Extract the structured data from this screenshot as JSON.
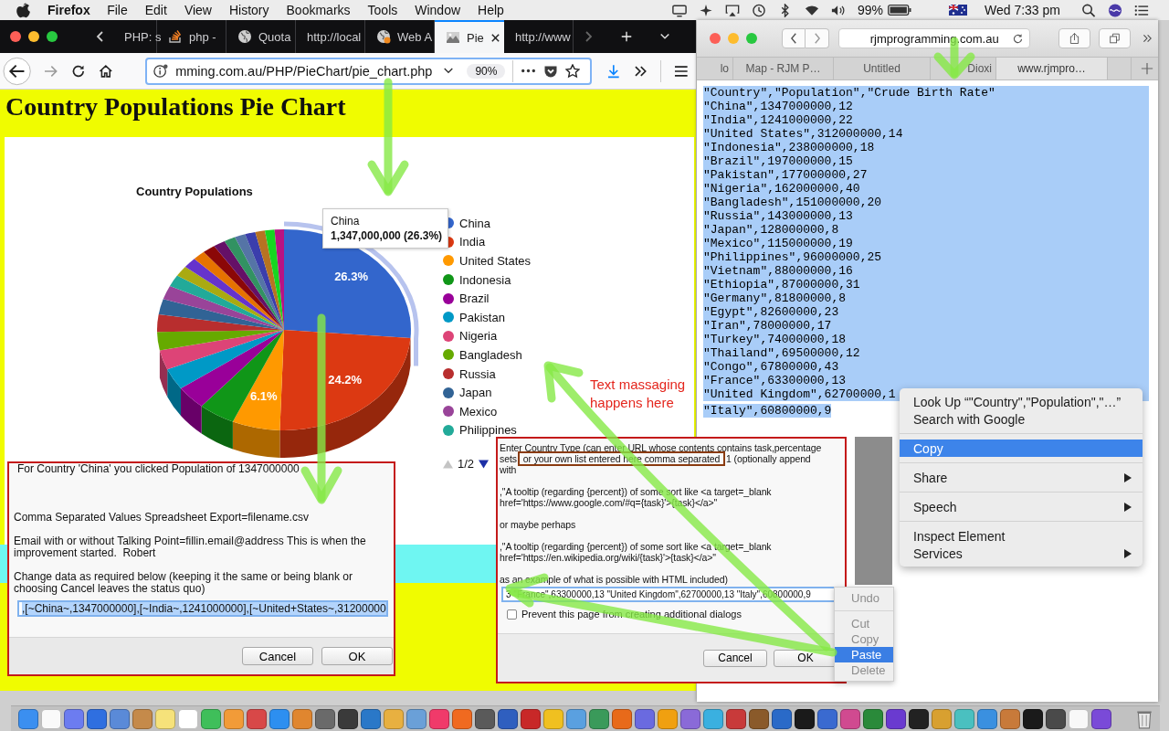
{
  "menu_bar": {
    "app": "Firefox",
    "items": [
      "File",
      "Edit",
      "View",
      "History",
      "Bookmarks",
      "Tools",
      "Window",
      "Help"
    ],
    "battery": "99%",
    "clock": "Wed 7:33 pm"
  },
  "firefox": {
    "tabs": [
      {
        "label": "PHP: s",
        "kind": "plain",
        "selected": false
      },
      {
        "label": "php -",
        "kind": "stack",
        "selected": false
      },
      {
        "label": "Quota",
        "kind": "globe",
        "selected": false
      },
      {
        "label": "http://local",
        "kind": "plain",
        "selected": false
      },
      {
        "label": "Web A",
        "kind": "globe",
        "selected": false
      },
      {
        "label": "Pie",
        "kind": "image",
        "selected": true
      },
      {
        "label": "http://www",
        "kind": "plain",
        "selected": false
      }
    ],
    "url": "mming.com.au/PHP/PieChart/pie_chart.php",
    "zoom": "90%",
    "page": {
      "heading": "Country Populations Pie Chart",
      "chart": {
        "title": "Country Populations",
        "slice_labels": [
          "26.3%",
          "24.2%",
          "6.1%"
        ],
        "tooltip": {
          "title": "China",
          "value": "1,347,000,000 (26.3%)"
        },
        "legend": [
          {
            "label": "China",
            "color": "#3366cc"
          },
          {
            "label": "India",
            "color": "#dc3912"
          },
          {
            "label": "United States",
            "color": "#ff9900"
          },
          {
            "label": "Indonesia",
            "color": "#109618"
          },
          {
            "label": "Brazil",
            "color": "#990099"
          },
          {
            "label": "Pakistan",
            "color": "#0099c6"
          },
          {
            "label": "Nigeria",
            "color": "#dd4477"
          },
          {
            "label": "Bangladesh",
            "color": "#66aa00"
          },
          {
            "label": "Russia",
            "color": "#b82e2e"
          },
          {
            "label": "Japan",
            "color": "#316395"
          },
          {
            "label": "Mexico",
            "color": "#994499"
          },
          {
            "label": "Philippines",
            "color": "#22aa99"
          }
        ],
        "pager": {
          "label": "1/2",
          "previous_disabled": true,
          "next_disabled": false
        }
      },
      "annotation": "Text massaging happens here"
    }
  },
  "prompt_left": {
    "message": [
      "For Country 'China' you clicked Population of 1347000000",
      "Comma Separated Values Spreadsheet Export=filename.csv",
      "Email with or without Talking Point=fillin.email@address This is when the improvement started.  Robert",
      "Change data as required below (keeping it the same or being blank or choosing Cancel leaves the status quo)"
    ],
    "field": {
      "value": ",[~China~,1347000000],[~India~,1241000000],[~United+States~,31200000",
      "selected": true
    },
    "buttons": [
      "Cancel",
      "OK"
    ]
  },
  "prompt_right": {
    "intro": {
      "before": "Enter Country Type (can enter URL whose contents contains task,percentage sets ",
      "boxed": "or your own list entered here comma separated",
      "after": " 1 (optionally append with"
    },
    "message": [
      ",\"A tooltip (regarding {percent}) of some sort like <a target=_blank href='https://www.google.com/#q={task}'>{task}</a>\"",
      "or maybe perhaps",
      ",\"A tooltip (regarding {percent}) of some sort like <a target=_blank href='https://en.wikipedia.org/wiki/{task}'>{task}</a>\"",
      "as an example of what is possible with HTML included)"
    ],
    "field": {
      "value": "3 \"France\",63300000,13 \"United Kingdom\",62700000,13 \"Italy\",60800000,9"
    },
    "checkbox": {
      "label": "Prevent this page from creating additional dialogs",
      "checked": false
    },
    "buttons": [
      "Cancel",
      "OK"
    ]
  },
  "edit_menu": {
    "groups": [
      [
        {
          "label": "Undo",
          "disabled": true,
          "selected": false
        }
      ],
      [
        {
          "label": "Cut",
          "disabled": true,
          "selected": false
        },
        {
          "label": "Copy",
          "disabled": true,
          "selected": false
        },
        {
          "label": "Paste",
          "disabled": false,
          "selected": true
        },
        {
          "label": "Delete",
          "disabled": true,
          "selected": false
        }
      ]
    ]
  },
  "safari": {
    "url": "rjmprogramming.com.au",
    "tabs": [
      {
        "label": "lo",
        "selected": false
      },
      {
        "label": "Map - RJM P…",
        "selected": false
      },
      {
        "label": "Untitled",
        "selected": false
      },
      {
        "label": "Dioxi",
        "selected": false
      },
      {
        "label": "www.rjmpro…",
        "selected": true
      }
    ],
    "lines": [
      {
        "text": "\"Country\",\"Population\",\"Crude Birth Rate\"",
        "selected": true
      },
      {
        "text": "\"China\",1347000000,12",
        "selected": true
      },
      {
        "text": "\"India\",1241000000,22",
        "selected": true
      },
      {
        "text": "\"United States\",312000000,14",
        "selected": true
      },
      {
        "text": "\"Indonesia\",238000000,18",
        "selected": true
      },
      {
        "text": "\"Brazil\",197000000,15",
        "selected": true
      },
      {
        "text": "\"Pakistan\",177000000,27",
        "selected": true
      },
      {
        "text": "\"Nigeria\",162000000,40",
        "selected": true
      },
      {
        "text": "\"Bangladesh\",151000000,20",
        "selected": true
      },
      {
        "text": "\"Russia\",143000000,13",
        "selected": true
      },
      {
        "text": "\"Japan\",128000000,8",
        "selected": true
      },
      {
        "text": "\"Mexico\",115000000,19",
        "selected": true
      },
      {
        "text": "\"Philippines\",96000000,25",
        "selected": true
      },
      {
        "text": "\"Vietnam\",88000000,16",
        "selected": true
      },
      {
        "text": "\"Ethiopia\",87000000,31",
        "selected": true
      },
      {
        "text": "\"Germany\",81800000,8",
        "selected": true
      },
      {
        "text": "\"Egypt\",82600000,23",
        "selected": true
      },
      {
        "text": "\"Iran\",78000000,17",
        "selected": true
      },
      {
        "text": "\"Turkey\",74000000,18",
        "selected": true
      },
      {
        "text": "\"Thailand\",69500000,12",
        "selected": true
      },
      {
        "text": "\"Congo\",67800000,43",
        "selected": true
      },
      {
        "text": "\"France\",63300000,13",
        "selected": true
      },
      {
        "text": "\"United Kingdom\",62700000,1",
        "selected": true
      },
      {
        "text": "\"Italy\",60800000,9",
        "selected": true
      }
    ],
    "context_menu": {
      "groups": [
        [
          {
            "label": "Look Up “\"Country\",\"Population\",\"…”",
            "selected": false,
            "submenu": false
          },
          {
            "label": "Search with Google",
            "selected": false,
            "submenu": false
          }
        ],
        [
          {
            "label": "Copy",
            "selected": true,
            "submenu": false
          }
        ],
        [
          {
            "label": "Share",
            "selected": false,
            "submenu": true
          }
        ],
        [
          {
            "label": "Speech",
            "selected": false,
            "submenu": true
          }
        ],
        [
          {
            "label": "Inspect Element",
            "selected": false,
            "submenu": false
          },
          {
            "label": "Services",
            "selected": false,
            "submenu": true
          }
        ]
      ]
    }
  }
}
